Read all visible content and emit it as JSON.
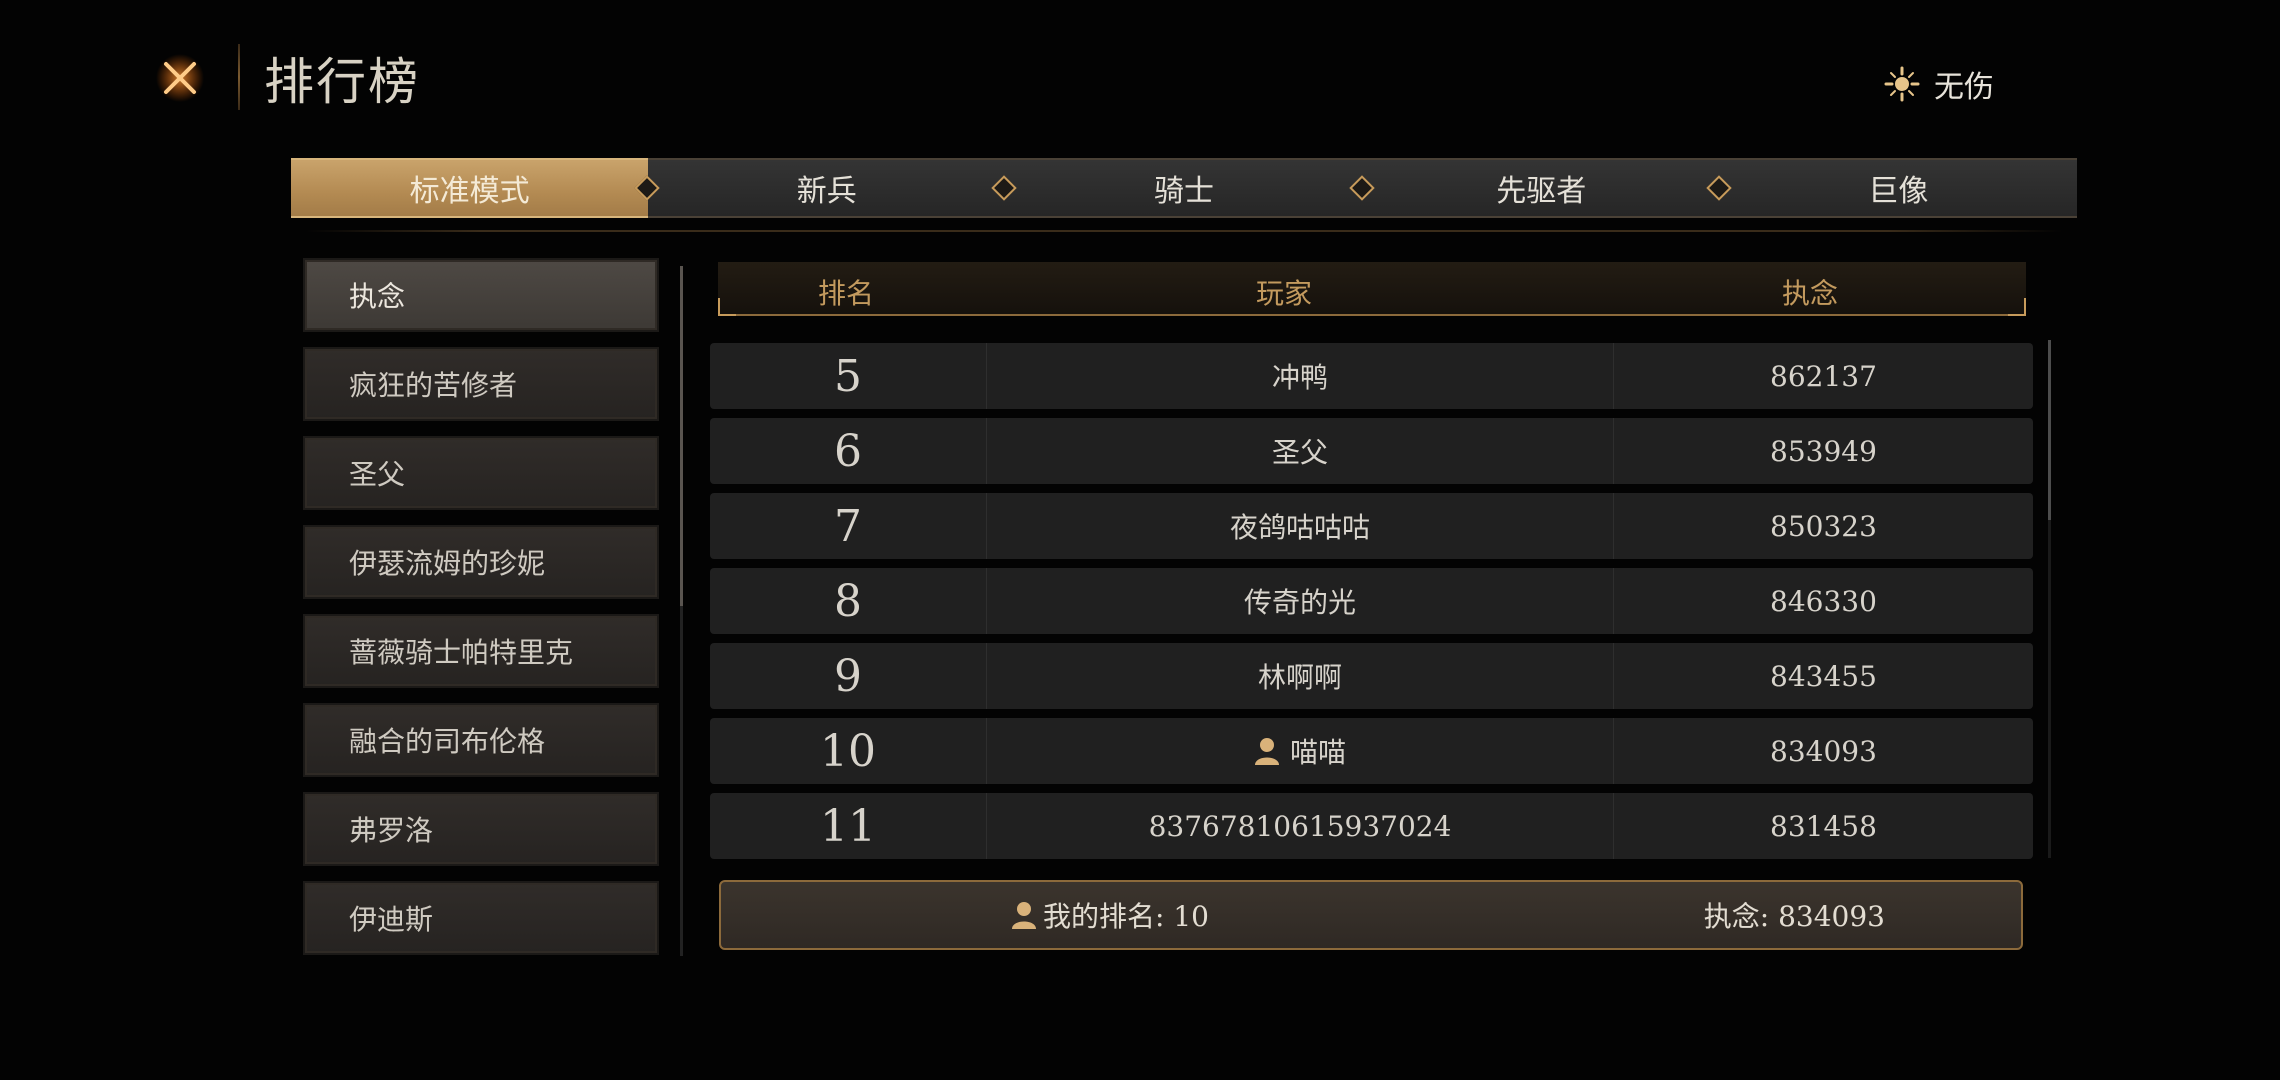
{
  "header": {
    "title": "排行榜",
    "mode_toggle_label": "无伤"
  },
  "tabs": [
    {
      "label": "标准模式",
      "active": true
    },
    {
      "label": "新兵",
      "active": false
    },
    {
      "label": "骑士",
      "active": false
    },
    {
      "label": "先驱者",
      "active": false
    },
    {
      "label": "巨像",
      "active": false
    }
  ],
  "sidebar": {
    "items": [
      {
        "label": "执念",
        "active": true
      },
      {
        "label": "疯狂的苦修者",
        "active": false
      },
      {
        "label": "圣父",
        "active": false
      },
      {
        "label": "伊瑟流姆的珍妮",
        "active": false
      },
      {
        "label": "蔷薇骑士帕特里克",
        "active": false
      },
      {
        "label": "融合的司布伦格",
        "active": false
      },
      {
        "label": "弗罗洛",
        "active": false
      },
      {
        "label": "伊迪斯",
        "active": false
      }
    ]
  },
  "table": {
    "columns": [
      "排名",
      "玩家",
      "执念"
    ],
    "rows": [
      {
        "rank": "5",
        "player": "冲鸭",
        "score": "862137",
        "is_me": false
      },
      {
        "rank": "6",
        "player": "圣父",
        "score": "853949",
        "is_me": false
      },
      {
        "rank": "7",
        "player": "夜鸽咕咕咕",
        "score": "850323",
        "is_me": false
      },
      {
        "rank": "8",
        "player": "传奇的光",
        "score": "846330",
        "is_me": false
      },
      {
        "rank": "9",
        "player": "林啊啊",
        "score": "843455",
        "is_me": false
      },
      {
        "rank": "10",
        "player": "喵喵",
        "score": "834093",
        "is_me": true
      },
      {
        "rank": "11",
        "player": "83767810615937024",
        "score": "831458",
        "is_me": false
      }
    ]
  },
  "my_rank": {
    "rank_label": "我的排名: 10",
    "score_label": "执念: 834093"
  },
  "colors": {
    "accent_gold": "#c79b5b",
    "active_tab": "#b38a52",
    "text": "#d7d3cb"
  }
}
